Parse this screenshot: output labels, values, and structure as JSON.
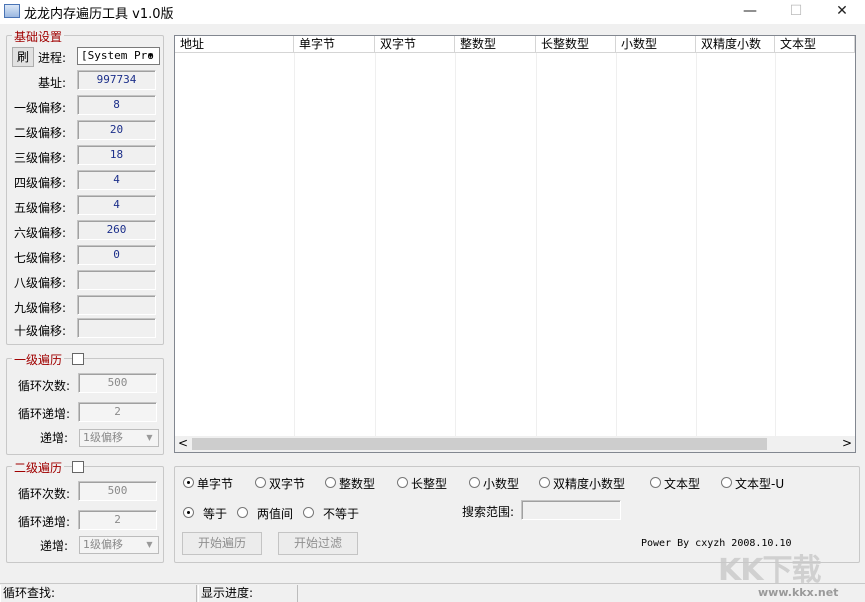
{
  "window": {
    "title": "龙龙内存遍历工具 v1.0版",
    "minimize": "—",
    "maximize": "☐",
    "close": "✕"
  },
  "base_settings": {
    "group_title": "基础设置",
    "refresh_button": "刷",
    "process_label": "进程:",
    "process_value": "[System Pro",
    "base_label": "基址:",
    "base_value": "997734",
    "offsets": [
      {
        "label": "一级偏移:",
        "value": "8"
      },
      {
        "label": "二级偏移:",
        "value": "20"
      },
      {
        "label": "三级偏移:",
        "value": "18"
      },
      {
        "label": "四级偏移:",
        "value": "4"
      },
      {
        "label": "五级偏移:",
        "value": "4"
      },
      {
        "label": "六级偏移:",
        "value": "260"
      },
      {
        "label": "七级偏移:",
        "value": "0"
      },
      {
        "label": "八级偏移:",
        "value": ""
      },
      {
        "label": "九级偏移:",
        "value": ""
      },
      {
        "label": "十级偏移:",
        "value": ""
      }
    ]
  },
  "level1": {
    "group_title": "一级遍历",
    "loop_count_label": "循环次数:",
    "loop_count": "500",
    "loop_step_label": "循环递增:",
    "loop_step": "2",
    "increment_label": "递增:",
    "increment_value": "1级偏移"
  },
  "level2": {
    "group_title": "二级遍历",
    "loop_count_label": "循环次数:",
    "loop_count": "500",
    "loop_step_label": "循环递增:",
    "loop_step": "2",
    "increment_label": "递增:",
    "increment_value": "1级偏移"
  },
  "results": {
    "columns": [
      "地址",
      "单字节",
      "双字节",
      "整数型",
      "长整数型",
      "小数型",
      "双精度小数",
      "文本型"
    ],
    "rows": [],
    "scroll_left": "<",
    "scroll_right": ">"
  },
  "search": {
    "types": [
      "单字节",
      "双字节",
      "整数型",
      "长整型",
      "小数型",
      "双精度小数型",
      "文本型",
      "文本型-U"
    ],
    "selected_type": "单字节",
    "compare": [
      "等于",
      "两值间",
      "不等于"
    ],
    "selected_compare": "等于",
    "range_label": "搜索范围:",
    "range_value": "",
    "start_traverse": "开始遍历",
    "start_filter": "开始过滤",
    "credit": "Power By cxyzh 2008.10.10"
  },
  "status": {
    "loop_search": "循环查找:",
    "progress": "显示进度:"
  },
  "watermark": {
    "brand": "KK下载",
    "url": "www.kkx.net"
  },
  "colors": {
    "group_title": "#a00000",
    "field_text": "#1c2f8a",
    "disabled_text": "#8f8f8f"
  }
}
